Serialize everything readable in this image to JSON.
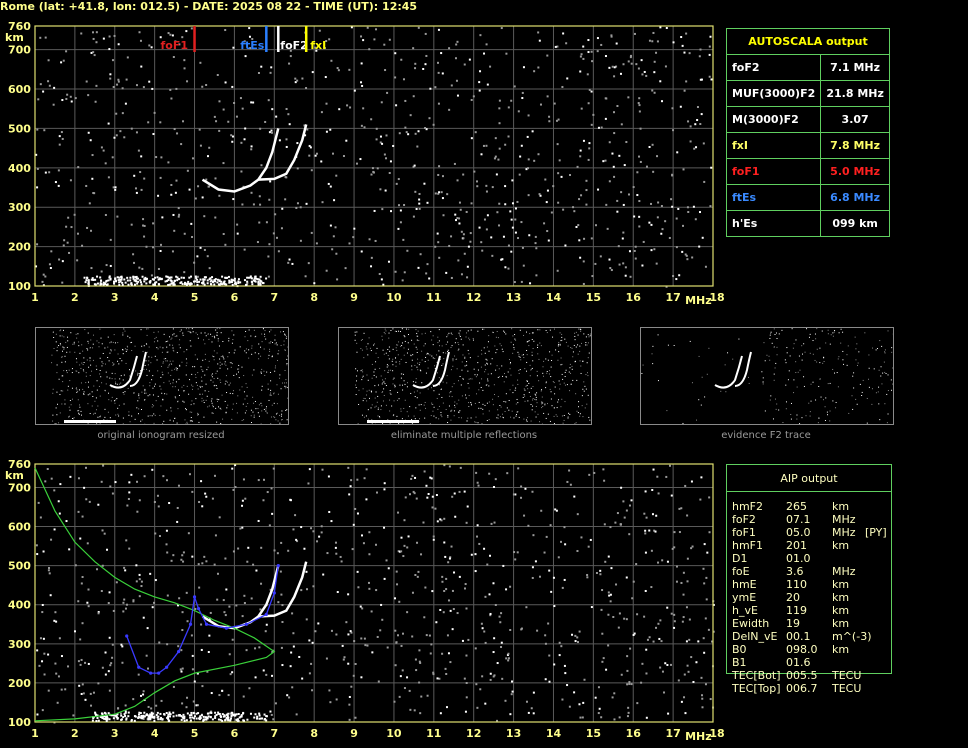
{
  "header": {
    "title": "Rome (lat: +41.8, lon: 012.5) - DATE: 2025 08 22 - TIME (UT): 12:45"
  },
  "axes": {
    "y_unit": "km",
    "x_unit": "MHz",
    "y_ticks": [
      "760",
      "700",
      "600",
      "500",
      "400",
      "300",
      "200",
      "100"
    ],
    "x_ticks": [
      "1",
      "2",
      "3",
      "4",
      "5",
      "6",
      "7",
      "8",
      "9",
      "10",
      "11",
      "12",
      "13",
      "14",
      "15",
      "16",
      "17",
      "18"
    ],
    "x_range": [
      1,
      18
    ],
    "y_range": [
      100,
      760
    ]
  },
  "markers": [
    {
      "label": "foF1",
      "freq": 5.0,
      "color": "#e02020"
    },
    {
      "label": "ftEs",
      "freq": 6.8,
      "color": "#2a7fff"
    },
    {
      "label": "foF2",
      "freq": 7.1,
      "color": "#ffffff"
    },
    {
      "label": "fxI",
      "freq": 7.8,
      "color": "#ffff00"
    }
  ],
  "autoscala": {
    "title": "AUTOSCALA output",
    "rows": [
      {
        "label": "foF2",
        "value": "7.1 MHz",
        "color": "#ffffff"
      },
      {
        "label": "MUF(3000)F2",
        "value": "21.8 MHz",
        "color": "#ffffff"
      },
      {
        "label": "M(3000)F2",
        "value": "3.07",
        "color": "#ffffff"
      },
      {
        "label": "fxI",
        "value": "7.8 MHz",
        "color": "#ffff66"
      },
      {
        "label": "foF1",
        "value": "5.0 MHz",
        "color": "#ff2020"
      },
      {
        "label": "ftEs",
        "value": "6.8 MHz",
        "color": "#3a8aff"
      },
      {
        "label": "h'Es",
        "value": "099     km",
        "color": "#ffffff"
      }
    ]
  },
  "thumbnails": [
    {
      "caption": "original ionogram resized"
    },
    {
      "caption": "eliminate multiple reflections"
    },
    {
      "caption": "evidence F2 trace"
    }
  ],
  "aip": {
    "title": "AIP output",
    "rows": [
      {
        "name": "hmF2",
        "value": "265",
        "unit": "km",
        "extra": ""
      },
      {
        "name": "foF2",
        "value": "07.1",
        "unit": "MHz",
        "extra": ""
      },
      {
        "name": "foF1",
        "value": "05.0",
        "unit": "MHz",
        "extra": "[PY]"
      },
      {
        "name": "hmF1",
        "value": "201",
        "unit": "km",
        "extra": ""
      },
      {
        "name": "D1",
        "value": "01.0",
        "unit": "",
        "extra": ""
      },
      {
        "name": "foE",
        "value": "3.6",
        "unit": "MHz",
        "extra": ""
      },
      {
        "name": "hmE",
        "value": "110",
        "unit": "km",
        "extra": ""
      },
      {
        "name": "ymE",
        "value": "20",
        "unit": "km",
        "extra": ""
      },
      {
        "name": "h_vE",
        "value": "119",
        "unit": "km",
        "extra": ""
      },
      {
        "name": "Ewidth",
        "value": "19",
        "unit": "km",
        "extra": ""
      },
      {
        "name": "DelN_vE",
        "value": "00.1",
        "unit": "m^(-3)",
        "extra": ""
      },
      {
        "name": "B0",
        "value": "098.0",
        "unit": "km",
        "extra": ""
      },
      {
        "name": "B1",
        "value": "01.6",
        "unit": "",
        "extra": ""
      },
      {
        "name": "TEC[Bot]",
        "value": "005.5",
        "unit": "TECU",
        "extra": ""
      },
      {
        "name": "TEC[Top]",
        "value": "006.7",
        "unit": "TECU",
        "extra": ""
      }
    ]
  },
  "chart_data": [
    {
      "type": "scatter",
      "name": "ionogram-autoscala",
      "x_range": [
        1,
        18
      ],
      "y_range": [
        100,
        760
      ],
      "series": [
        {
          "name": "O trace F",
          "x": [
            5.2,
            5.6,
            6.0,
            6.4,
            6.6,
            6.8,
            6.95,
            7.05,
            7.1
          ],
          "y": [
            370,
            345,
            340,
            355,
            370,
            400,
            440,
            480,
            500
          ]
        },
        {
          "name": "X trace F",
          "x": [
            6.6,
            7.0,
            7.3,
            7.5,
            7.7,
            7.8
          ],
          "y": [
            370,
            372,
            385,
            420,
            470,
            510
          ]
        },
        {
          "name": "Es layer",
          "x": [
            2.2,
            3,
            4,
            5,
            6,
            6.8
          ],
          "y": [
            112,
            116,
            118,
            116,
            114,
            112
          ]
        }
      ]
    },
    {
      "type": "line",
      "name": "ionogram-aip",
      "x_range": [
        1,
        18
      ],
      "y_range": [
        100,
        760
      ],
      "series": [
        {
          "name": "electron density profile",
          "x": [
            1.0,
            1.5,
            2.0,
            2.5,
            3.0,
            3.5,
            4.0,
            4.5,
            5.0,
            5.5,
            6.0,
            6.5,
            7.0,
            6.8,
            6.0,
            5.0,
            4.5,
            4.0,
            3.5,
            3.0,
            2.0,
            1.0
          ],
          "y": [
            750,
            640,
            560,
            510,
            470,
            440,
            420,
            405,
            385,
            360,
            340,
            315,
            280,
            265,
            245,
            225,
            205,
            175,
            140,
            120,
            108,
            103
          ]
        },
        {
          "name": "fitted trace",
          "x": [
            3.3,
            3.6,
            3.9,
            4.1,
            4.3,
            4.6,
            4.9,
            5.0,
            5.1,
            5.3,
            5.8,
            6.3,
            6.8,
            7.0,
            7.1
          ],
          "y": [
            320,
            240,
            225,
            225,
            240,
            280,
            350,
            420,
            390,
            350,
            340,
            350,
            375,
            430,
            500
          ]
        }
      ]
    }
  ]
}
